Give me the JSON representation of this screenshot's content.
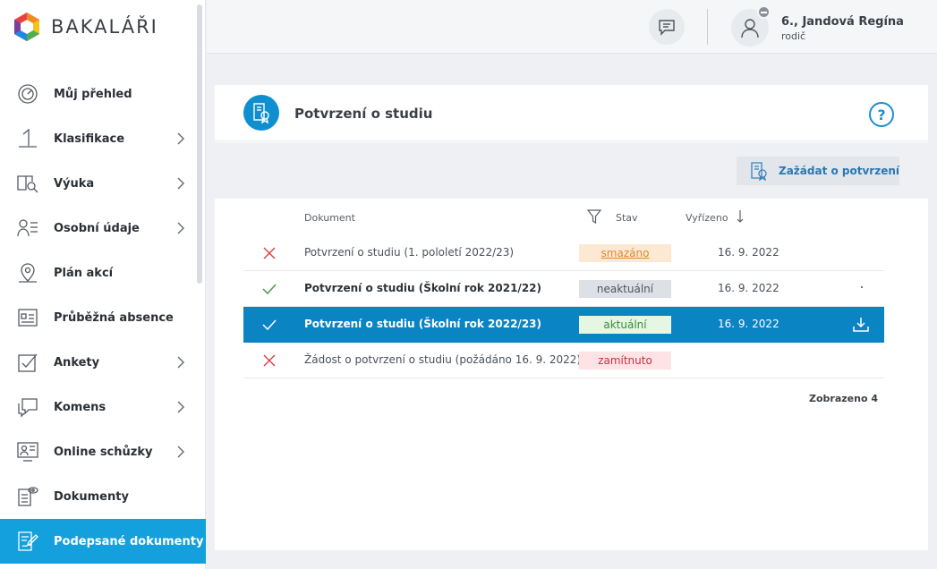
{
  "app": {
    "name": "BAKALÁŘI"
  },
  "colors": {
    "accent": "#14a0dc",
    "selected_row": "#0b84c3",
    "deleted": "#d98a2e",
    "current": "#3d8a3a",
    "rejected": "#c8323f"
  },
  "sidebar": {
    "items": [
      {
        "label": "Můj přehled",
        "icon": "dashboard-icon",
        "has_children": false
      },
      {
        "label": "Klasifikace",
        "icon": "grade-one-icon",
        "has_children": true
      },
      {
        "label": "Výuka",
        "icon": "book-search-icon",
        "has_children": true
      },
      {
        "label": "Osobní údaje",
        "icon": "person-list-icon",
        "has_children": true
      },
      {
        "label": "Plán akcí",
        "icon": "map-pin-icon",
        "has_children": false
      },
      {
        "label": "Průběžná absence",
        "icon": "id-card-icon",
        "has_children": false
      },
      {
        "label": "Ankety",
        "icon": "checkbox-icon",
        "has_children": true
      },
      {
        "label": "Komens",
        "icon": "chat-icon",
        "has_children": true
      },
      {
        "label": "Online schůzky",
        "icon": "video-meeting-icon",
        "has_children": true
      },
      {
        "label": "Dokumenty",
        "icon": "document-eye-icon",
        "has_children": false
      },
      {
        "label": "Podepsané dokumenty",
        "icon": "signed-document-icon",
        "has_children": false,
        "active": true
      }
    ]
  },
  "header": {
    "user_name": "6., Jandová Regína",
    "user_role": "rodič"
  },
  "page": {
    "title": "Potvrzení o studiu",
    "help": "?",
    "request_button": "Zažádat o potvrzení"
  },
  "table": {
    "columns": {
      "document": "Dokument",
      "state": "Stav",
      "resolved": "Vyřízeno"
    },
    "rows": [
      {
        "status": "x",
        "document": "Potvrzení o studiu (1. pololetí 2022/23)",
        "state": "smazáno",
        "state_kind": "deleted",
        "date": "16. 9. 2022",
        "bold": false
      },
      {
        "status": "check",
        "document": "Potvrzení o studiu (Školní rok 2021/22)",
        "state": "neaktuální",
        "state_kind": "outdated",
        "date": "16. 9. 2022",
        "bold": true
      },
      {
        "status": "check",
        "document": "Potvrzení o studiu (Školní rok 2022/23)",
        "state": "aktuální",
        "state_kind": "current",
        "date": "16. 9. 2022",
        "bold": true,
        "selected": true
      },
      {
        "status": "x",
        "document": "Žádost o potvrzení o studiu (požádáno 16. 9. 2022)",
        "state": "zamítnuto",
        "state_kind": "rejected",
        "date": "",
        "bold": false
      }
    ],
    "footer": "Zobrazeno 4"
  }
}
